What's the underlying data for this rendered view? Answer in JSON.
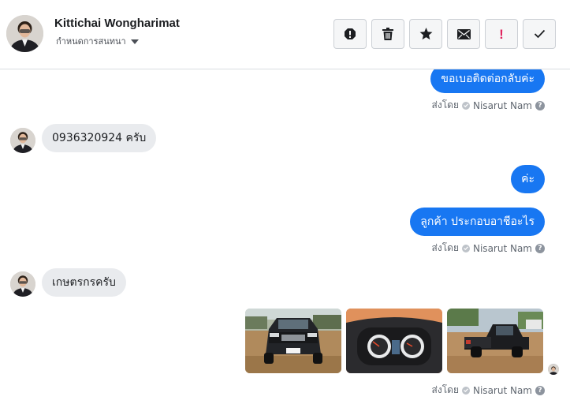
{
  "header": {
    "contact_name": "Kittichai Wongharimat",
    "settings_label": "กำหนดการสนทนา",
    "actions": [
      {
        "name": "report-icon"
      },
      {
        "name": "trash-icon"
      },
      {
        "name": "star-icon"
      },
      {
        "name": "envelope-icon"
      },
      {
        "name": "important-icon",
        "glyph": "!"
      },
      {
        "name": "checkmark-icon"
      }
    ]
  },
  "thread": {
    "messages": [
      {
        "direction": "out",
        "text": "ขอเบอติดต่อกลับค่ะ"
      },
      {
        "direction": "meta",
        "text": "ส่งโดย",
        "sender": "Nisarut Nam",
        "help": "?"
      },
      {
        "direction": "in",
        "text": "0936320924 ครับ"
      },
      {
        "direction": "out",
        "text": "ค่ะ"
      },
      {
        "direction": "out",
        "text": "ลูกค้า ประกอบอาชีอะไร"
      },
      {
        "direction": "meta",
        "text": "ส่งโดย",
        "sender": "Nisarut Nam",
        "help": "?"
      },
      {
        "direction": "in",
        "text": "เกษตรกรครับ"
      },
      {
        "direction": "out",
        "type": "photos",
        "photos": [
          "pickup-front-photo",
          "dashboard-gauges-photo",
          "pickup-rear-photo"
        ]
      },
      {
        "direction": "meta",
        "text": "ส่งโดย",
        "sender": "Nisarut Nam",
        "help": "?"
      }
    ]
  },
  "colors": {
    "accent": "#1877f2",
    "incoming_bubble": "#e9ebee",
    "important": "#e0245e"
  }
}
